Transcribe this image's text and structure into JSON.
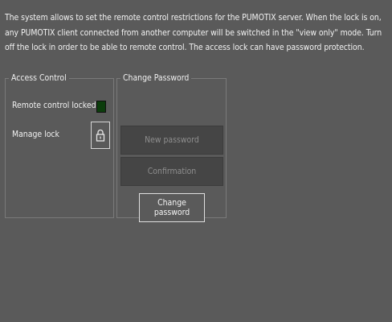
{
  "description": "The system allows to set the remote control restrictions for the PUMOTIX server. When the lock is on, any PUMOTIX client connected from another computer will be switched in the \"view only\" mode. Turn off the lock in order to be able to remote control. The access lock can have password protection.",
  "access_control": {
    "title": "Access Control",
    "remote_locked_label": "Remote control locked",
    "remote_locked": true,
    "indicator_color": "#0c3d0c",
    "manage_lock_label": "Manage lock",
    "lock_icon": "padlock-icon"
  },
  "change_password": {
    "title": "Change Password",
    "new_password_placeholder": "New password",
    "confirmation_placeholder": "Confirmation",
    "button_label": "Change password"
  },
  "colors": {
    "background": "#5a5a5a",
    "input_background": "#454545",
    "border": "#7a7a7a"
  }
}
